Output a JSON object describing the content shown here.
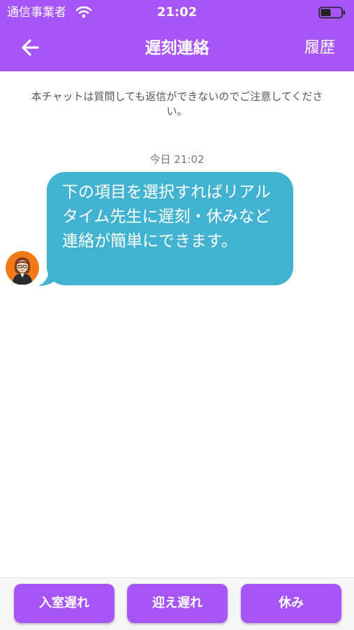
{
  "status_bar": {
    "carrier": "通信事業者",
    "time": "21:02",
    "wifi_icon": "wifi-icon",
    "battery_icon": "battery-icon"
  },
  "nav": {
    "back_icon": "arrow-left-icon",
    "title": "遅刻連絡",
    "history_label": "履歴"
  },
  "notice": "本チャットは質問しても返信ができないのでご注意してください。",
  "chat": {
    "date_stamp": "今日 21:02",
    "messages": [
      {
        "sender_avatar": "teacher-avatar-icon",
        "text": "下の項目を選択すればリアルタイム先生に遅刻・休みなど連絡が簡単にできます。"
      }
    ]
  },
  "actions": [
    {
      "label": "入室遅れ"
    },
    {
      "label": "迎え遅れ"
    },
    {
      "label": "休み"
    }
  ],
  "colors": {
    "accent": "#a855f7",
    "bubble": "#41b3d0",
    "background": "#ffffff"
  }
}
